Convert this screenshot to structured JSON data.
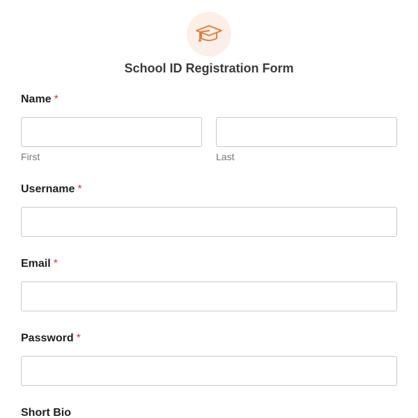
{
  "header": {
    "icon": "graduation-cap-icon",
    "icon_color": "#e57c3d",
    "icon_bg": "#fcefe8",
    "title": "School ID Registration Form"
  },
  "fields": {
    "name": {
      "label": "Name",
      "required_mark": "*",
      "first_value": "",
      "last_value": "",
      "first_sublabel": "First",
      "last_sublabel": "Last"
    },
    "username": {
      "label": "Username",
      "required_mark": "*",
      "value": ""
    },
    "email": {
      "label": "Email",
      "required_mark": "*",
      "value": ""
    },
    "password": {
      "label": "Password",
      "required_mark": "*",
      "value": ""
    },
    "short_bio": {
      "label": "Short Bio"
    }
  },
  "colors": {
    "required": "#d63638",
    "border": "#c9c9c9",
    "label": "#1f1f1f"
  }
}
